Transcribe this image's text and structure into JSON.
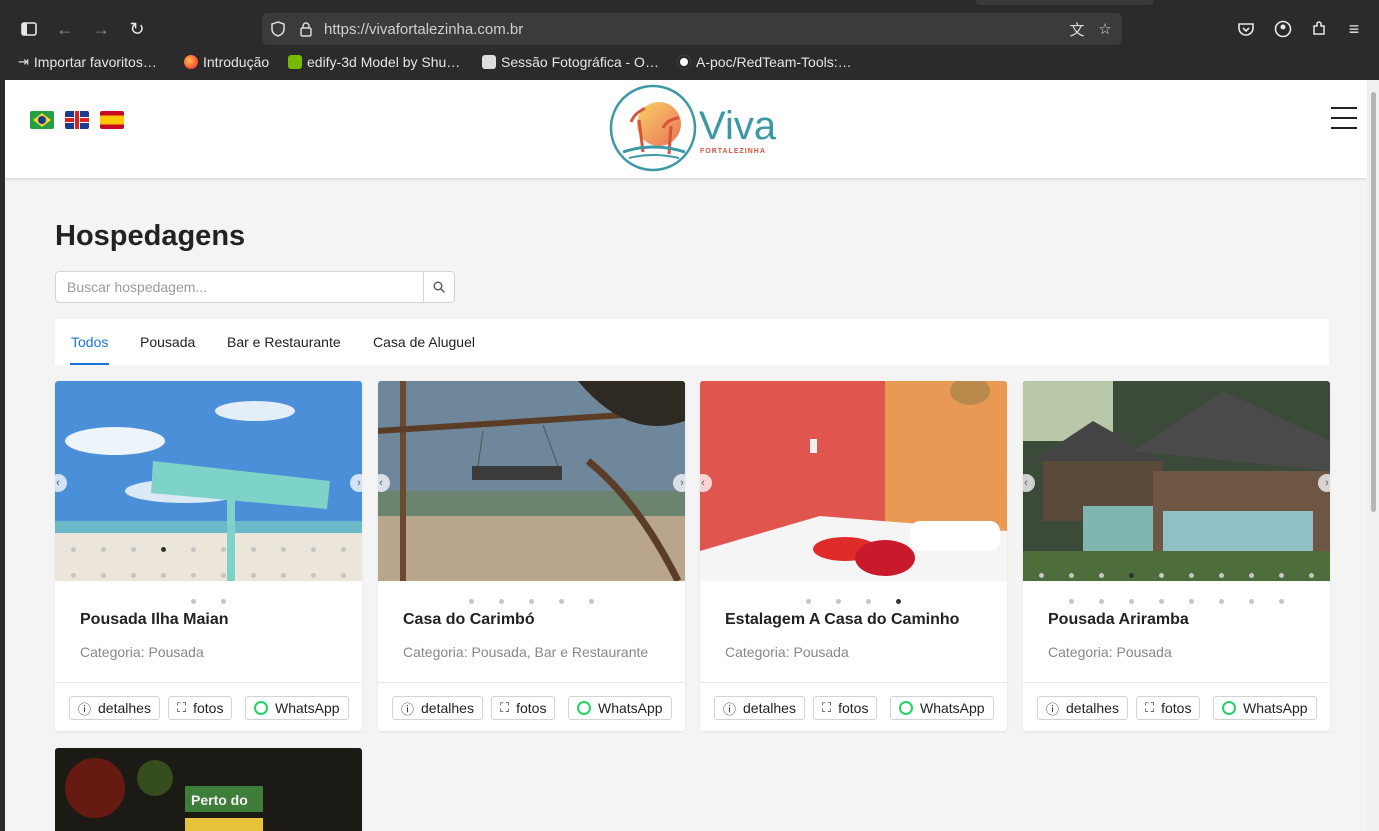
{
  "browser": {
    "url": "https://vivafortalezinha.com.br",
    "bookmarks": [
      {
        "label": "Importar favoritos…",
        "icon": "import-icon"
      },
      {
        "label": "Introdução",
        "icon": "firefox-icon"
      },
      {
        "label": "edify-3d Model by Shu…",
        "icon": "nvidia-icon"
      },
      {
        "label": "Sessão Fotográfica - O…",
        "icon": "page-icon"
      },
      {
        "label": "A-poc/RedTeam-Tools:…",
        "icon": "github-icon"
      }
    ]
  },
  "header": {
    "logo_text": "Viva",
    "logo_subtext": "FORTALEZINHA",
    "languages": [
      "pt-BR",
      "en-GB",
      "es"
    ]
  },
  "main": {
    "title": "Hospedagens",
    "search_placeholder": "Buscar hospedagem...",
    "tabs": [
      "Todos",
      "Pousada",
      "Bar e Restaurante",
      "Casa de Aluguel"
    ],
    "active_tab": "Todos"
  },
  "cards": [
    {
      "name": "Pousada Ilha Maian",
      "category": "Categoria: Pousada",
      "dots": 12,
      "active_dot": 3
    },
    {
      "name": "Casa do Carimbó",
      "category": "Categoria: Pousada, Bar e Restaurante",
      "dots": 5,
      "active_dot": -1
    },
    {
      "name": "Estalagem A Casa do Caminho",
      "category": "Categoria: Pousada",
      "dots": 4,
      "active_dot": 3
    },
    {
      "name": "Pousada Ariramba",
      "category": "Categoria: Pousada",
      "dots": 8,
      "active_dot": 3
    }
  ],
  "card_actions": {
    "details": "detalhes",
    "photos": "fotos",
    "whatsapp": "WhatsApp"
  },
  "partial_card_sign": "Perto do",
  "colors": {
    "accent": "#1976d2",
    "brand": "#3b98a4",
    "whatsapp": "#25d366"
  }
}
